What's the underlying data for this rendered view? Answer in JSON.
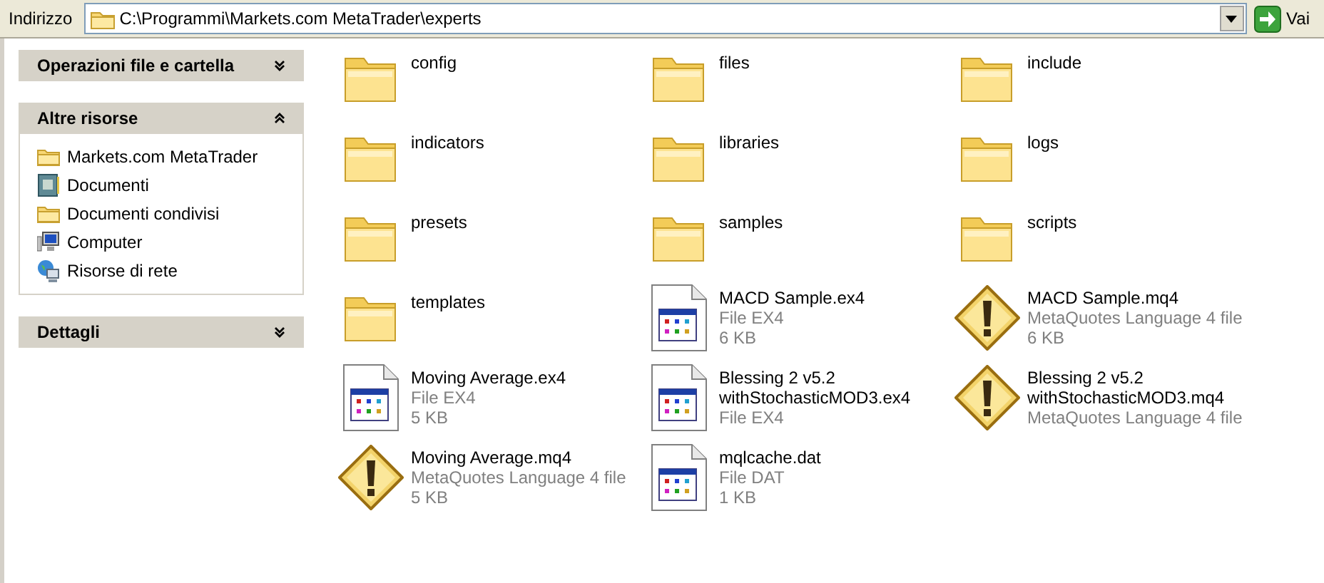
{
  "address_bar": {
    "label": "Indirizzo",
    "path": "C:\\Programmi\\Markets.com MetaTrader\\experts",
    "go_button": "Vai"
  },
  "sidebar": {
    "panels": [
      {
        "title": "Operazioni file e cartella",
        "expanded": false
      },
      {
        "title": "Altre risorse",
        "expanded": true,
        "items": [
          {
            "label": "Markets.com MetaTrader",
            "kind": "folder"
          },
          {
            "label": "Documenti",
            "kind": "documents"
          },
          {
            "label": "Documenti condivisi",
            "kind": "folder"
          },
          {
            "label": "Computer",
            "kind": "computer"
          },
          {
            "label": "Risorse di rete",
            "kind": "network"
          }
        ]
      },
      {
        "title": "Dettagli",
        "expanded": false
      }
    ]
  },
  "files": [
    {
      "name": "config",
      "kind": "folder"
    },
    {
      "name": "files",
      "kind": "folder"
    },
    {
      "name": "include",
      "kind": "folder"
    },
    {
      "name": "indicators",
      "kind": "folder"
    },
    {
      "name": "libraries",
      "kind": "folder"
    },
    {
      "name": "logs",
      "kind": "folder"
    },
    {
      "name": "presets",
      "kind": "folder"
    },
    {
      "name": "samples",
      "kind": "folder"
    },
    {
      "name": "scripts",
      "kind": "folder"
    },
    {
      "name": "templates",
      "kind": "folder"
    },
    {
      "name": "MACD Sample.ex4",
      "kind": "program",
      "type": "File EX4",
      "size": "6 KB"
    },
    {
      "name": "MACD Sample.mq4",
      "kind": "warning",
      "type": "MetaQuotes Language 4 file",
      "size": "6 KB"
    },
    {
      "name": "Moving Average.ex4",
      "kind": "program",
      "type": "File EX4",
      "size": "5 KB"
    },
    {
      "name": "Blessing 2 v5.2 withStochasticMOD3.ex4",
      "kind": "program",
      "type": "File EX4"
    },
    {
      "name": "Blessing 2 v5.2 withStochasticMOD3.mq4",
      "kind": "warning",
      "type": "MetaQuotes Language 4 file"
    },
    {
      "name": "Moving Average.mq4",
      "kind": "warning",
      "type": "MetaQuotes Language 4 file",
      "size": "5 KB"
    },
    {
      "name": "mqlcache.dat",
      "kind": "program",
      "type": "File DAT",
      "size": "1 KB"
    }
  ]
}
